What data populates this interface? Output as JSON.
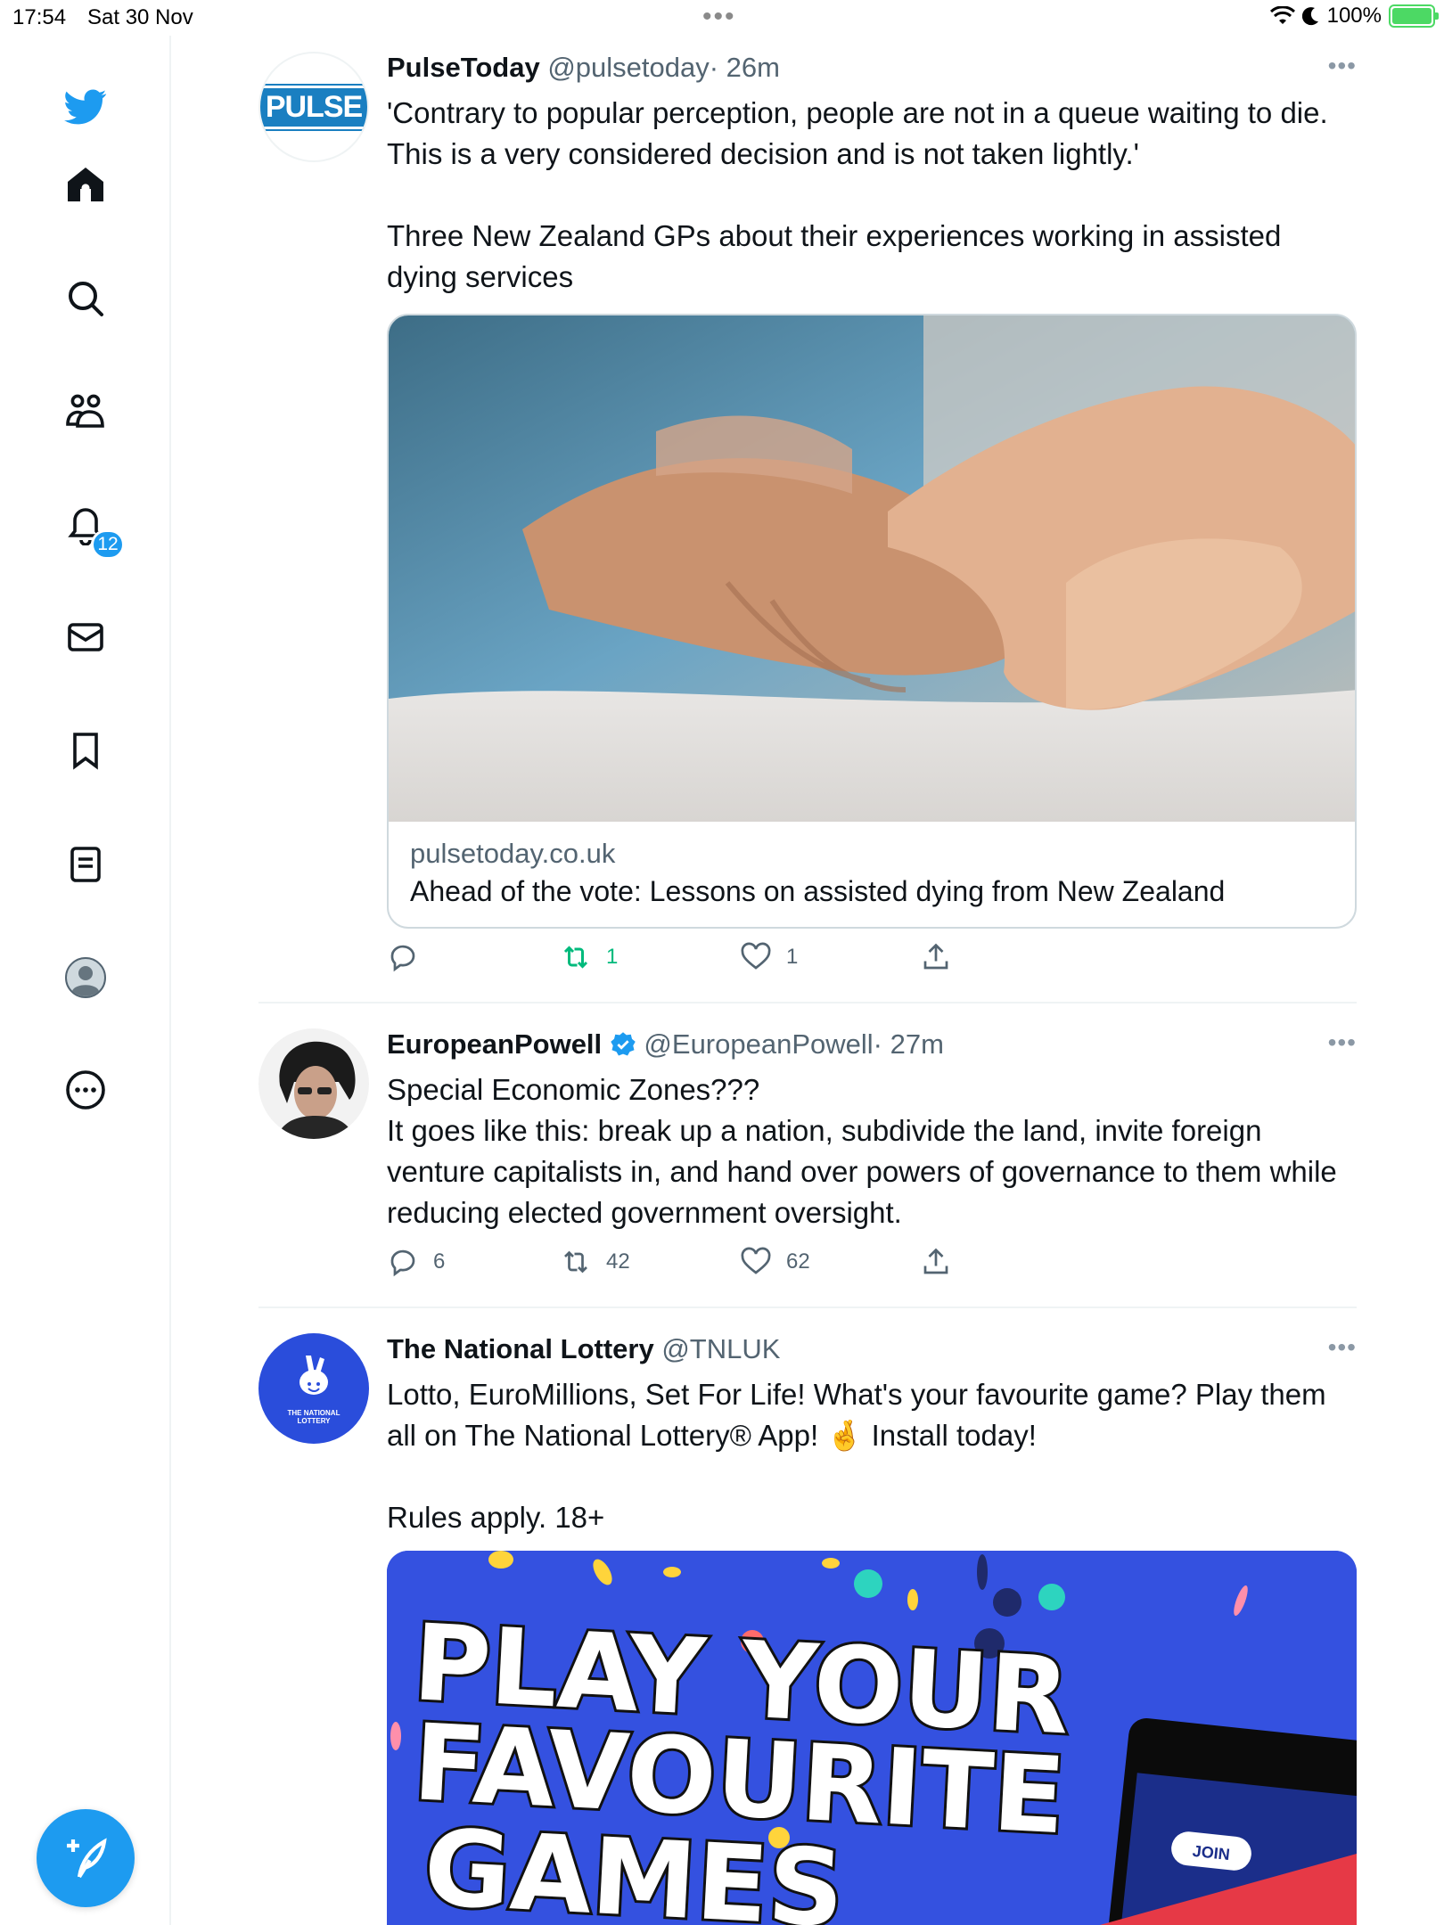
{
  "status_bar": {
    "time": "17:54",
    "date": "Sat 30 Nov",
    "battery": "100%"
  },
  "sidebar": {
    "notifications_badge": "12",
    "items": [
      {
        "icon": "twitter-logo-icon"
      },
      {
        "icon": "home-icon"
      },
      {
        "icon": "search-icon"
      },
      {
        "icon": "communities-icon"
      },
      {
        "icon": "notifications-icon"
      },
      {
        "icon": "messages-icon"
      },
      {
        "icon": "bookmarks-icon"
      },
      {
        "icon": "lists-icon"
      },
      {
        "icon": "profile-icon"
      },
      {
        "icon": "more-icon"
      }
    ],
    "compose_icon": "compose-icon"
  },
  "tweets": [
    {
      "name": "PulseToday",
      "handle": "@pulsetoday",
      "time": "· 26m",
      "avatar_text": "PULSE",
      "text": "'Contrary to popular perception, people are not in a queue waiting to die. This is a very considered decision and is not taken lightly.'\n\nThree New Zealand GPs about their experiences working in assisted dying services",
      "card": {
        "domain": "pulsetoday.co.uk",
        "title": "Ahead of the vote: Lessons on assisted dying from New Zealand"
      },
      "replies": "",
      "retweets": "1",
      "likes": "1"
    },
    {
      "name": "EuropeanPowell",
      "handle": "@EuropeanPowell",
      "time": "· 27m",
      "text": "Special Economic Zones???\nIt goes like this: break up a nation, subdivide the land, invite foreign venture capitalists in, and hand over powers of governance to them while reducing elected government oversight.",
      "replies": "6",
      "retweets": "42",
      "likes": "62"
    },
    {
      "name": "The National Lottery",
      "handle": "@TNLUK",
      "time": "",
      "avatar_text": "THE NATIONAL LOTTERY",
      "text": "Lotto, EuroMillions, Set For Life! What's your favourite game? Play them all on The National Lottery® App! 🤞 Install today!\n\nRules apply. 18+",
      "promo": {
        "headline_line1": "PLAY YOUR",
        "headline_line2": "FAVOURITE",
        "headline_line3": "GAMES",
        "join_label": "JOIN"
      }
    }
  ],
  "colors": {
    "accent": "#1d9bf0",
    "retweet_active": "#00ba7c",
    "promo_bg": "#3451e0"
  }
}
